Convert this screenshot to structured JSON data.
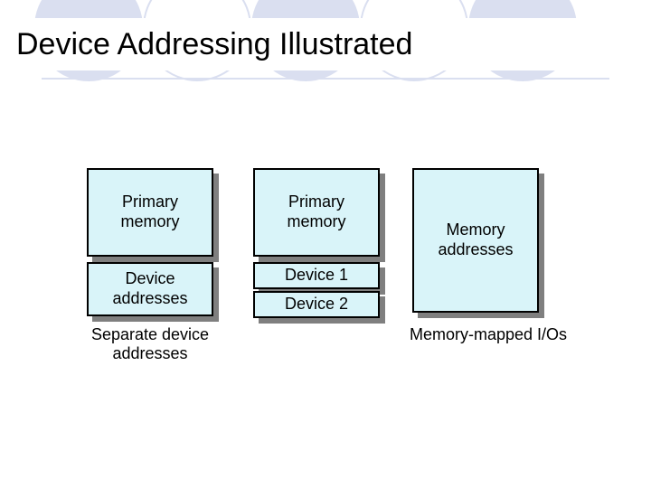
{
  "title": "Device Addressing Illustrated",
  "columns": {
    "left": {
      "primary": "Primary\nmemory",
      "device": "Device\naddresses",
      "caption": "Separate device\naddresses"
    },
    "middle": {
      "primary": "Primary\nmemory",
      "device1": "Device 1",
      "device2": "Device 2"
    },
    "right": {
      "memory": "Memory\naddresses",
      "caption": "Memory-mapped I/Os"
    }
  }
}
